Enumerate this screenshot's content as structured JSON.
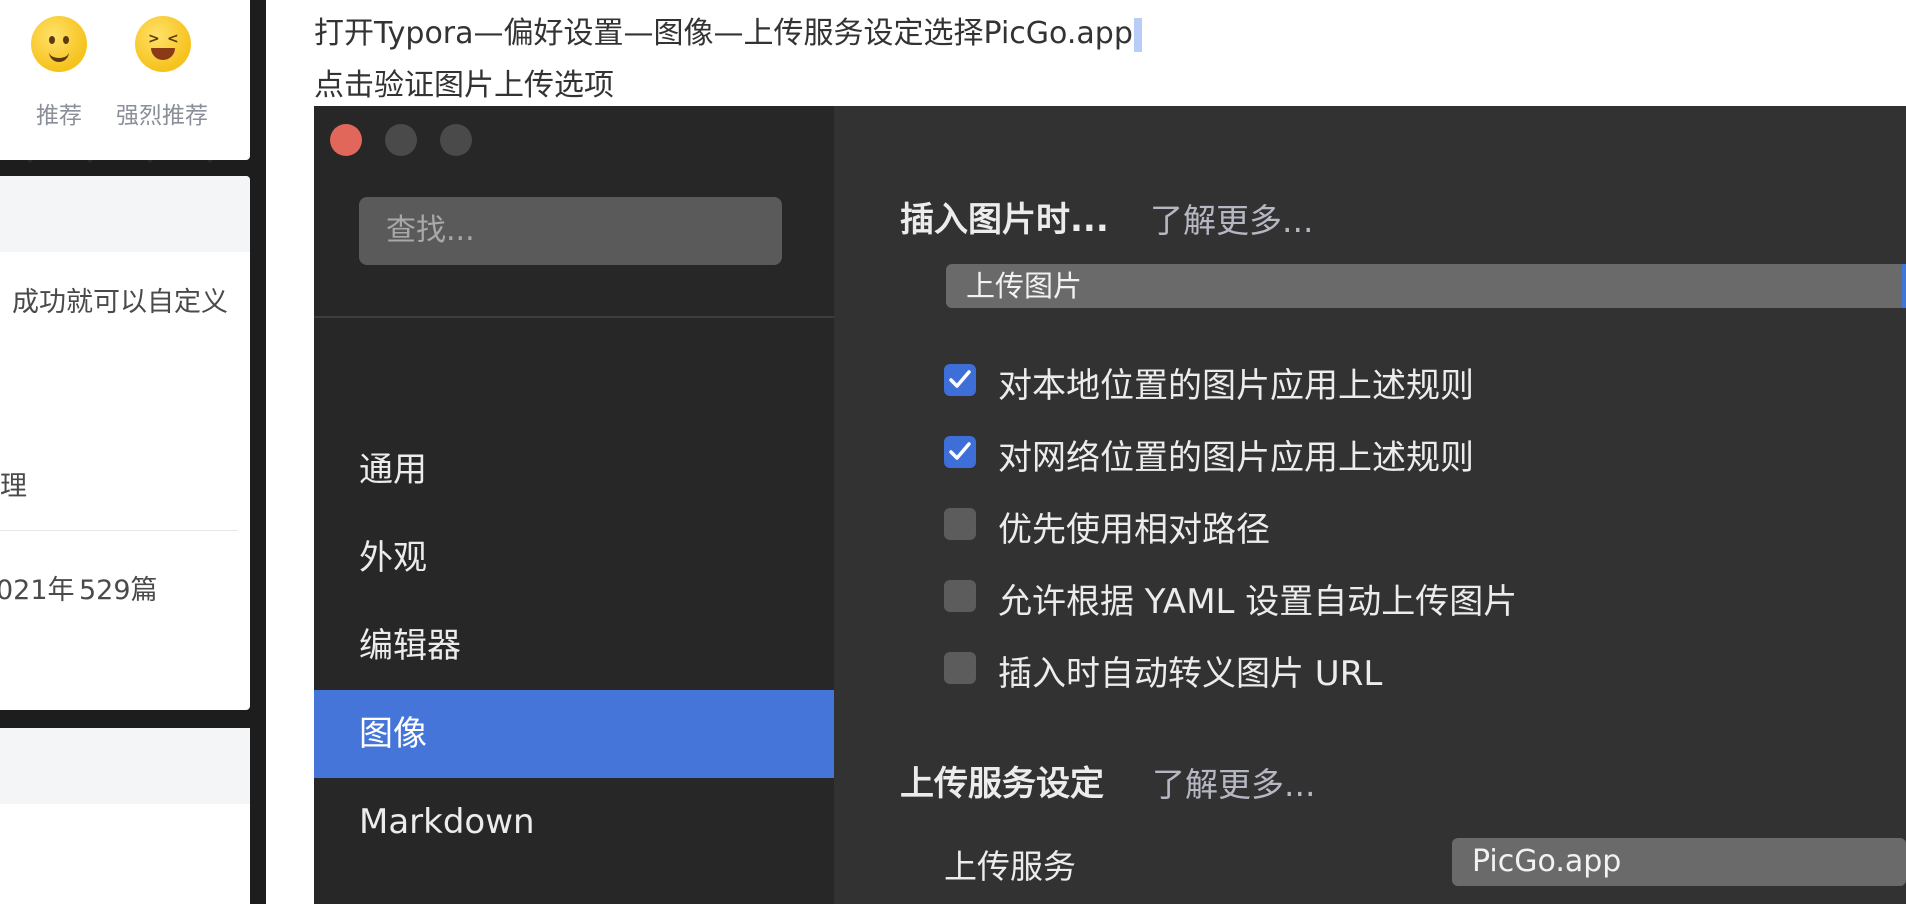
{
  "left_sidebar": {
    "reactions": [
      {
        "label": "推荐",
        "icon": "smiley-face-icon"
      },
      {
        "label": "强烈推荐",
        "icon": "laughing-face-icon"
      }
    ],
    "snippet_text": "成功就可以自定义",
    "item_text": "理",
    "stats_year": "021年",
    "stats_posts": "529篇"
  },
  "article": {
    "line1": "打开Typora—偏好设置—图像—上传服务设定选择PicGo.app",
    "line2": "点击验证图片上传选项"
  },
  "preferences": {
    "search_placeholder": "查找...",
    "nav": [
      {
        "label": "通用",
        "active": false
      },
      {
        "label": "外观",
        "active": false
      },
      {
        "label": "编辑器",
        "active": false
      },
      {
        "label": "图像",
        "active": true
      },
      {
        "label": "Markdown",
        "active": false
      }
    ],
    "insert_image": {
      "title": "插入图片时...",
      "learn_more": "了解更多...",
      "action_value": "上传图片"
    },
    "options": [
      {
        "label": "对本地位置的图片应用上述规则",
        "checked": true
      },
      {
        "label": "对网络位置的图片应用上述规则",
        "checked": true
      },
      {
        "label": "优先使用相对路径",
        "checked": false
      },
      {
        "label": "允许根据 YAML 设置自动上传图片",
        "checked": false
      },
      {
        "label": "插入时自动转义图片 URL",
        "checked": false
      }
    ],
    "upload_service": {
      "title": "上传服务设定",
      "learn_more": "了解更多...",
      "field_label": "上传服务",
      "value": "PicGo.app"
    },
    "colors": {
      "accent": "#4675d9",
      "close_button": "#e0675a",
      "window_bg": "#323232",
      "sidebar_bg": "#272727"
    }
  }
}
